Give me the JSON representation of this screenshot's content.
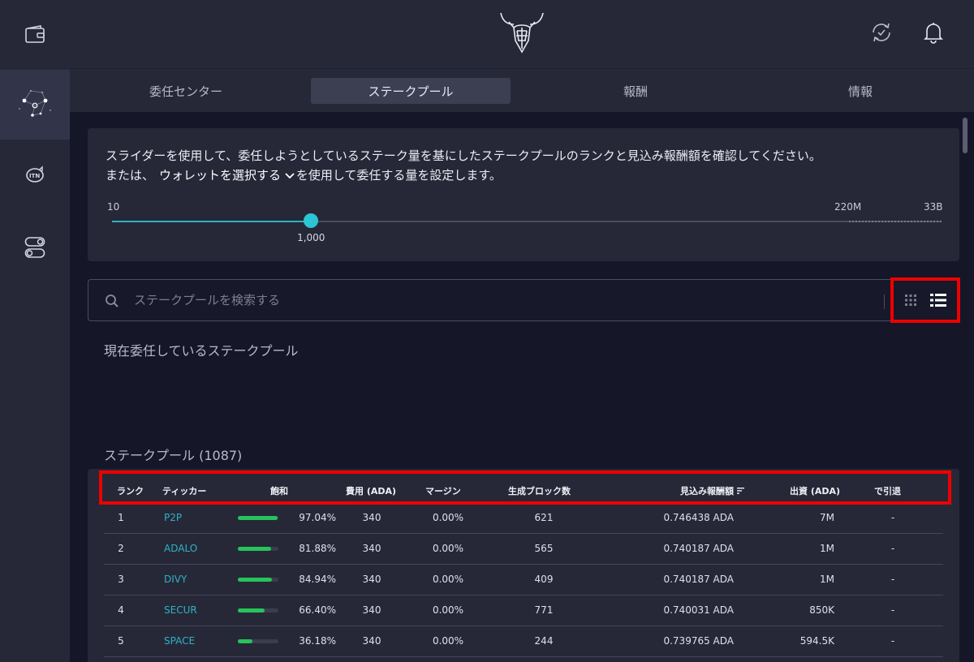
{
  "tabs": [
    {
      "label": "委任センター"
    },
    {
      "label": "ステークプール"
    },
    {
      "label": "報酬"
    },
    {
      "label": "情報"
    }
  ],
  "slider": {
    "text_line1": "スライダーを使用して、委任しようとしているステーク量を基にしたステークプールのランクと見込み報酬額を確認してください。",
    "text_line2_pre": "または、",
    "wallet_select": "ウォレットを選択する",
    "text_line2_post": "を使用して委任する量を設定します。",
    "min_label": "10",
    "mark_label": "220M",
    "max_label": "33B",
    "value": "1,000",
    "position_fraction": 0.24
  },
  "search": {
    "placeholder": "ステークプールを検索する"
  },
  "sections": {
    "current_delegation": "現在委任しているステークプール",
    "stake_pools": "ステークプール (1087)"
  },
  "table": {
    "headers": {
      "rank": "ランク",
      "ticker": "ティッカー",
      "saturation": "飽和",
      "cost": "費用 (ADA)",
      "margin": "マージン",
      "blocks": "生成ブロック数",
      "rewards": "見込み報酬額",
      "pledge": "出資 (ADA)",
      "retiring": "で引退"
    },
    "rows": [
      {
        "rank": "1",
        "ticker": "P2P",
        "saturation": "97.04%",
        "sat_fraction": 0.9704,
        "cost": "340",
        "margin": "0.00%",
        "blocks": "621",
        "rewards": "0.746438 ADA",
        "pledge": "7M",
        "retiring": "-"
      },
      {
        "rank": "2",
        "ticker": "ADALO",
        "saturation": "81.88%",
        "sat_fraction": 0.8188,
        "cost": "340",
        "margin": "0.00%",
        "blocks": "565",
        "rewards": "0.740187 ADA",
        "pledge": "1M",
        "retiring": "-"
      },
      {
        "rank": "3",
        "ticker": "DIVY",
        "saturation": "84.94%",
        "sat_fraction": 0.8494,
        "cost": "340",
        "margin": "0.00%",
        "blocks": "409",
        "rewards": "0.740187 ADA",
        "pledge": "1M",
        "retiring": "-"
      },
      {
        "rank": "4",
        "ticker": "SECUR",
        "saturation": "66.40%",
        "sat_fraction": 0.664,
        "cost": "340",
        "margin": "0.00%",
        "blocks": "771",
        "rewards": "0.740031 ADA",
        "pledge": "850K",
        "retiring": "-"
      },
      {
        "rank": "5",
        "ticker": "SPACE",
        "saturation": "36.18%",
        "sat_fraction": 0.3618,
        "cost": "340",
        "margin": "0.00%",
        "blocks": "244",
        "rewards": "0.739765 ADA",
        "pledge": "594.5K",
        "retiring": "-"
      }
    ]
  },
  "colors": {
    "accent": "#2cc6d3",
    "ticker": "#2fb2c4",
    "saturation_fill": "#26c35a",
    "highlight": "#ee0000"
  }
}
